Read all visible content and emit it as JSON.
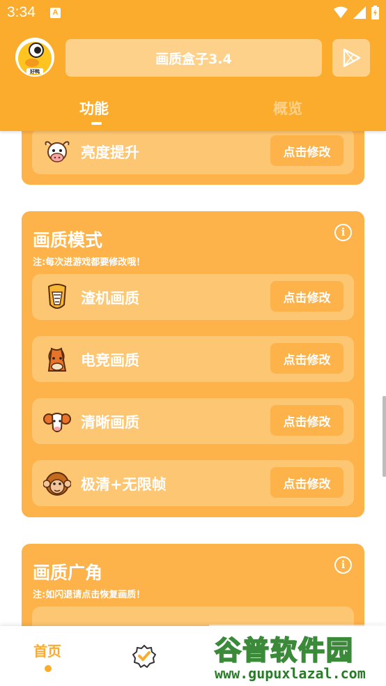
{
  "status_bar": {
    "time": "3:34",
    "notification_icon_letter": "A"
  },
  "header": {
    "app_title": "画质盒子3.4",
    "avatar_label": "好鸭",
    "tabs": [
      {
        "label": "功能",
        "active": true
      },
      {
        "label": "概览",
        "active": false
      }
    ]
  },
  "cards": [
    {
      "rows": [
        {
          "icon": "cow-icon",
          "label": "亮度提升",
          "button": "点击修改"
        }
      ]
    },
    {
      "title": "画质模式",
      "note": "注:每次进游戏都要修改哦！",
      "rows": [
        {
          "icon": "cobra-icon",
          "label": "渣机画质",
          "button": "点击修改"
        },
        {
          "icon": "horse-icon",
          "label": "电竞画质",
          "button": "点击修改"
        },
        {
          "icon": "ram-icon",
          "label": "清晰画质",
          "button": "点击修改"
        },
        {
          "icon": "monkey-icon",
          "label": "极清+无限帧",
          "button": "点击修改"
        }
      ]
    },
    {
      "title": "画质广角",
      "note": "注:如闪退请点击恢复画质！"
    }
  ],
  "bottom_nav": {
    "home_label": "首页"
  },
  "watermark": {
    "title": "谷普软件园",
    "url": "www.gupuxlazal.com"
  },
  "colors": {
    "accent": "#fcac2c",
    "card": "#fdb24a",
    "row": "#fdc672",
    "title_box": "#fdd18a"
  }
}
